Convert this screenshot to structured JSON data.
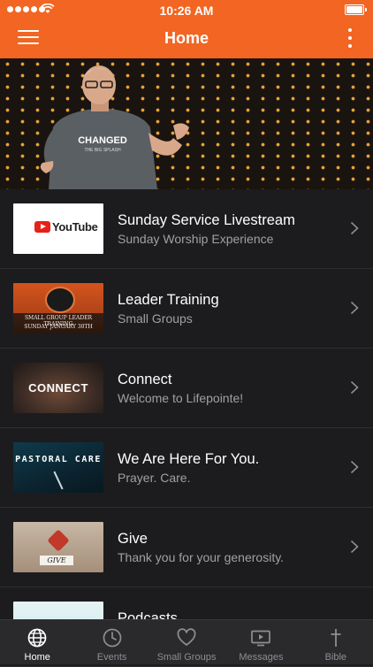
{
  "status_bar": {
    "time": "10:26 AM"
  },
  "header": {
    "title": "Home"
  },
  "list": [
    {
      "title": "Sunday Service Livestream",
      "subtitle": "Sunday Worship Experience",
      "thumb_text": "YouTube"
    },
    {
      "title": "Leader Training",
      "subtitle": "Small Groups",
      "thumb_line1": "SMALL GROUP LEADER TRAINING",
      "thumb_line2": "SUNDAY JANUARY 30TH"
    },
    {
      "title": "Connect",
      "subtitle": "Welcome to Lifepointe!",
      "thumb_text": "CONNECT"
    },
    {
      "title": "We Are Here For You.",
      "subtitle": "Prayer. Care.",
      "thumb_text": "PASTORAL CARE"
    },
    {
      "title": "Give",
      "subtitle": "Thank you for your generosity.",
      "thumb_text": "GIVE"
    },
    {
      "title": "Podcasts",
      "subtitle": ""
    }
  ],
  "tabs": [
    {
      "label": "Home",
      "icon": "globe-icon",
      "active": true
    },
    {
      "label": "Events",
      "icon": "clock-icon",
      "active": false
    },
    {
      "label": "Small Groups",
      "icon": "heart-icon",
      "active": false
    },
    {
      "label": "Messages",
      "icon": "video-icon",
      "active": false
    },
    {
      "label": "Bible",
      "icon": "cross-icon",
      "active": false
    }
  ],
  "colors": {
    "brand": "#f26522",
    "background": "#1c1c1e",
    "tab_bar": "#2a2a2c"
  }
}
